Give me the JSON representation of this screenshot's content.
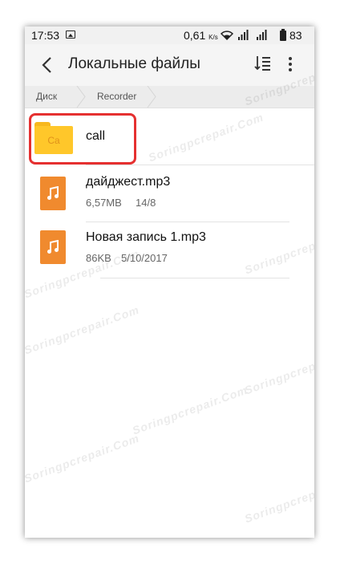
{
  "status_bar": {
    "time": "17:53",
    "speed": "0,61",
    "speed_unit": "K/s",
    "battery": "83"
  },
  "toolbar": {
    "title": "Локальные файлы"
  },
  "breadcrumb": [
    "Диск",
    "Recorder"
  ],
  "files": [
    {
      "name": "call",
      "type": "folder",
      "icon_label": "Ca"
    },
    {
      "name": "дайджест.mp3",
      "size": "6,57MB",
      "date": "14/8",
      "type": "audio"
    },
    {
      "name": "Новая запись 1.mp3",
      "size": "86KB",
      "date": "5/10/2017",
      "type": "audio"
    }
  ],
  "watermark": "Soringpcrepair.Com",
  "colors": {
    "folder": "#ffc72a",
    "audio_icon": "#f08a2e",
    "highlight": "#e53030"
  }
}
